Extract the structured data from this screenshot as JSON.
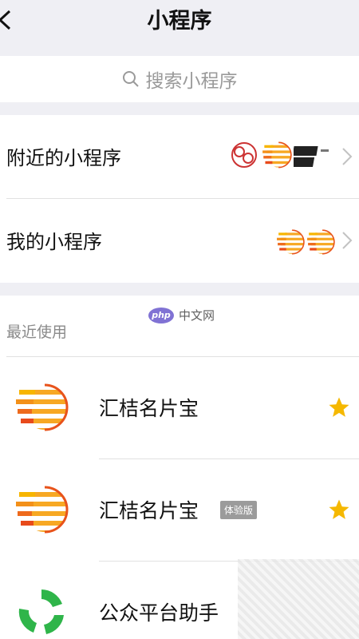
{
  "nav": {
    "title": "小程序",
    "back_icon": "chevron-left-icon"
  },
  "search": {
    "placeholder": "搜索小程序",
    "icon": "search-icon"
  },
  "menu": [
    {
      "label": "附近的小程序",
      "icon": "chevron-right-icon"
    },
    {
      "label": "我的小程序",
      "icon": "chevron-right-icon"
    }
  ],
  "recent": {
    "title": "最近使用",
    "items": [
      {
        "name": "汇桔名片宝",
        "badge": "",
        "starred": true
      },
      {
        "name": "汇桔名片宝",
        "badge": "体验版",
        "starred": true
      },
      {
        "name": "公众平台助手",
        "badge": "",
        "starred": false
      }
    ]
  },
  "watermark": {
    "logo": "php",
    "text": "中文网"
  },
  "colors": {
    "star": "#f5b800",
    "logo_orange": "#f0731e",
    "logo_yellow": "#f7b500",
    "helper_green": "#2fb54a"
  }
}
